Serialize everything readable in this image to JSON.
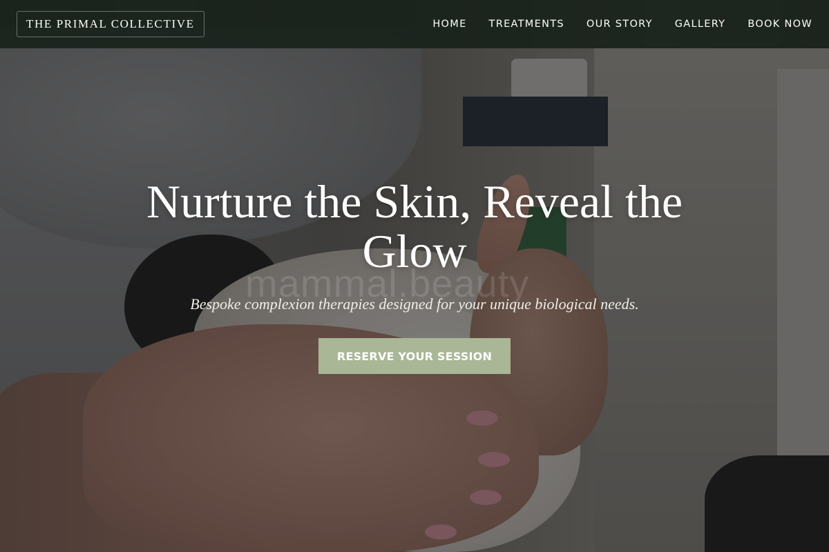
{
  "site": {
    "brand": "THE PRIMAL COLLECTIVE"
  },
  "nav": {
    "items": [
      {
        "label": "HOME"
      },
      {
        "label": "TREATMENTS"
      },
      {
        "label": "OUR STORY"
      },
      {
        "label": "GALLERY"
      },
      {
        "label": "BOOK NOW"
      }
    ]
  },
  "hero": {
    "title": "Nurture the Skin, Reveal the Glow",
    "subtitle": "Bespoke complexion therapies designed for your unique biological needs.",
    "cta_label": "RESERVE YOUR SESSION",
    "watermark": "mammal.beauty",
    "image_subject": "facial-treatment-photo"
  },
  "colors": {
    "navbar_bg": "#162018",
    "cta_bg": "#a9b796",
    "text_light": "#ffffff"
  }
}
